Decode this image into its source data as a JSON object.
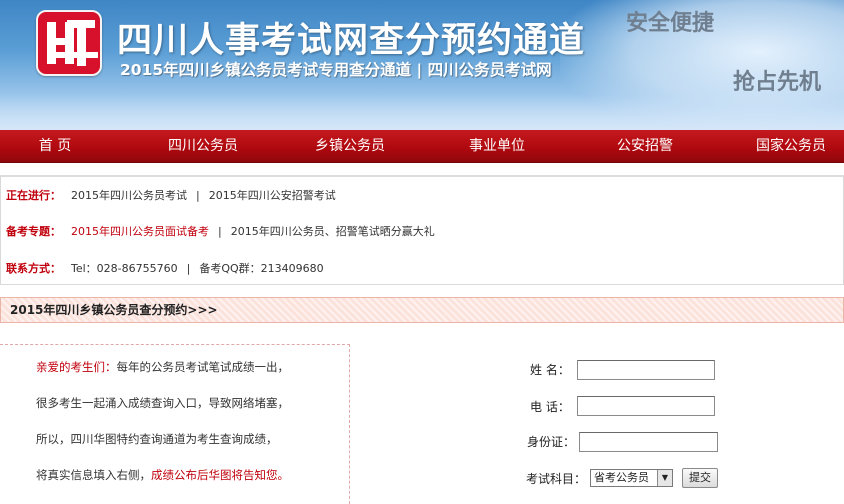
{
  "header": {
    "title": "四川人事考试网查分预约通道",
    "subtitle": "2015年四川乡镇公务员考试专用查分通道 | 四川公务员考试网",
    "slogan_1": "安全便捷",
    "slogan_2": "抢占先机",
    "logo_icon": "ht-logo-icon",
    "brand_color": "#c41a1f"
  },
  "nav": {
    "items": [
      "首 页",
      "四川公务员",
      "乡镇公务员",
      "事业单位",
      "公安招警",
      "国家公务员"
    ]
  },
  "info": {
    "ongoing": {
      "label": "正在进行：",
      "item_1": "2015年四川公务员考试",
      "item_2": "2015年四川公安招警考试"
    },
    "prep": {
      "label": "备考专题：",
      "item_1": "2015年四川公务员面试备考",
      "item_2": "2015年四川公务员、招警笔试晒分赢大礼"
    },
    "contact": {
      "label": "联系方式：",
      "tel": "Tel：028-86755760",
      "qq": "备考QQ群：213409680"
    },
    "separator": "|"
  },
  "section": {
    "title": "2015年四川乡镇公务员查分预约>>>"
  },
  "notice": {
    "greeting": "亲爱的考生们：",
    "line_1": "每年的公务员考试笔试成绩一出，",
    "line_2": "很多考生一起涌入成绩查询入口，导致网络堵塞，",
    "line_3": "所以，四川华图特约查询通道为考生查询成绩，",
    "line_4a": "将真实信息填入右侧，",
    "line_4b": "成绩公布后华图将告知您。"
  },
  "form": {
    "name_label": "姓  名：",
    "name_value": "",
    "phone_label": "电  话：",
    "phone_value": "",
    "id_label": "身份证：",
    "id_value": "",
    "subject_label": "考试科目：",
    "subject_selected": "省考公务员",
    "submit_label": "提交"
  }
}
